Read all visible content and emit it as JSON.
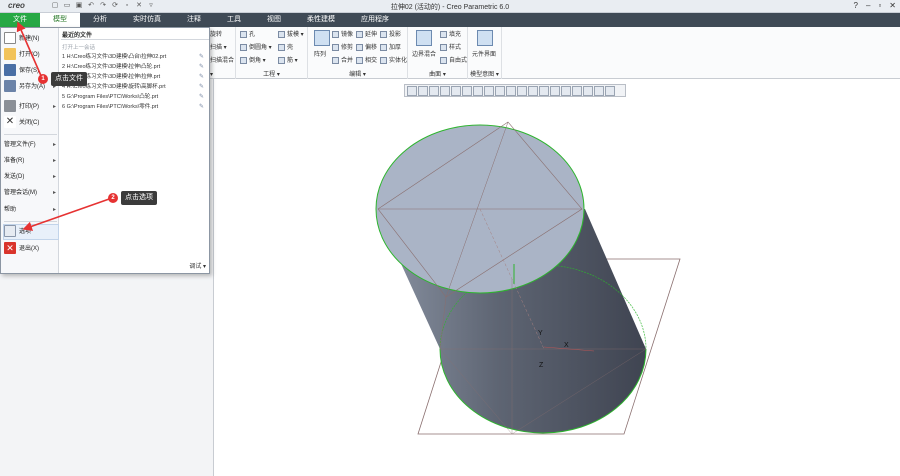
{
  "app": {
    "logo": "creo",
    "window_title": "拉伸02 (活动的) - Creo Parametric 6.0"
  },
  "tabs": [
    {
      "label": "文件"
    },
    {
      "label": "模型"
    },
    {
      "label": "分析"
    },
    {
      "label": "实时仿真"
    },
    {
      "label": "注释"
    },
    {
      "label": "工具"
    },
    {
      "label": "视图"
    },
    {
      "label": "柔性建模"
    },
    {
      "label": "应用程序"
    }
  ],
  "ribbon": {
    "col1": [
      "旋转",
      "扫描 ▾",
      "扫描混合"
    ],
    "col2": [
      "孔",
      "倒圆角 ▾",
      "倒角 ▾"
    ],
    "col3": [
      "拔模 ▾",
      "壳",
      "筋 ▾"
    ],
    "engineering_title": "工程 ▾",
    "array_label": "阵列",
    "edit_col1": [
      "镜像",
      "修剪",
      "合并"
    ],
    "edit_col2": [
      "延伸",
      "偏移",
      "相交"
    ],
    "edit_col3": [
      "投影",
      "加厚",
      "实体化"
    ],
    "edit_title": "编辑 ▾",
    "surface_big": "边界混合",
    "surface_col": [
      "填充",
      "样式",
      "自由式"
    ],
    "surface_title": "曲面 ▾",
    "model_intent_big": "元件界面",
    "model_intent_title": "模型意图 ▾",
    "left_partial_title": "▾"
  },
  "file_menu": {
    "items": [
      {
        "label": "新建(N)"
      },
      {
        "label": "打开(O)"
      },
      {
        "label": "保存(S)"
      },
      {
        "label": "另存为(A)"
      },
      {
        "label": "打印(P)"
      },
      {
        "label": "关闭(C)"
      },
      {
        "label": "管理文件(F)"
      },
      {
        "label": "准备(R)"
      },
      {
        "label": "发送(D)"
      },
      {
        "label": "管理会话(M)"
      },
      {
        "label": "帮助"
      },
      {
        "label": "选项"
      },
      {
        "label": "退出(X)"
      }
    ],
    "recent_title": "最近的文件",
    "recent_sub": "打开上一会话",
    "recent_files": [
      "1 H:\\Creo练习文件\\3D建模\\凸台\\拉伸02.prt",
      "2 H:\\Creo练习文件\\3D建模\\拉伸\\凸轮.prt",
      "3 H:\\Creo练习文件\\3D建模\\拉伸\\拉伸.prt",
      "4 H:\\Creo练习文件\\3D建模\\旋转\\高脚杯.prt",
      "5 G:\\Program Files\\PTC\\Works\\凸轮.prt",
      "6 G:\\Program Files\\PTC\\Works\\零件.prt"
    ],
    "debug_label": "调试 ▾"
  },
  "callouts": [
    {
      "number": "1",
      "text": "点击文件"
    },
    {
      "number": "2",
      "text": "点击选项"
    }
  ],
  "axes": {
    "x": "X",
    "y": "Y",
    "z": "Z"
  },
  "colors": {
    "file_tab": "#27a844",
    "ribbon_tab_bar": "#3f4a56",
    "cylinder_side": "#4c5260",
    "cylinder_top": "#aab4c6",
    "highlight_edge": "#2db52d",
    "callout_arrow": "#e63232"
  }
}
